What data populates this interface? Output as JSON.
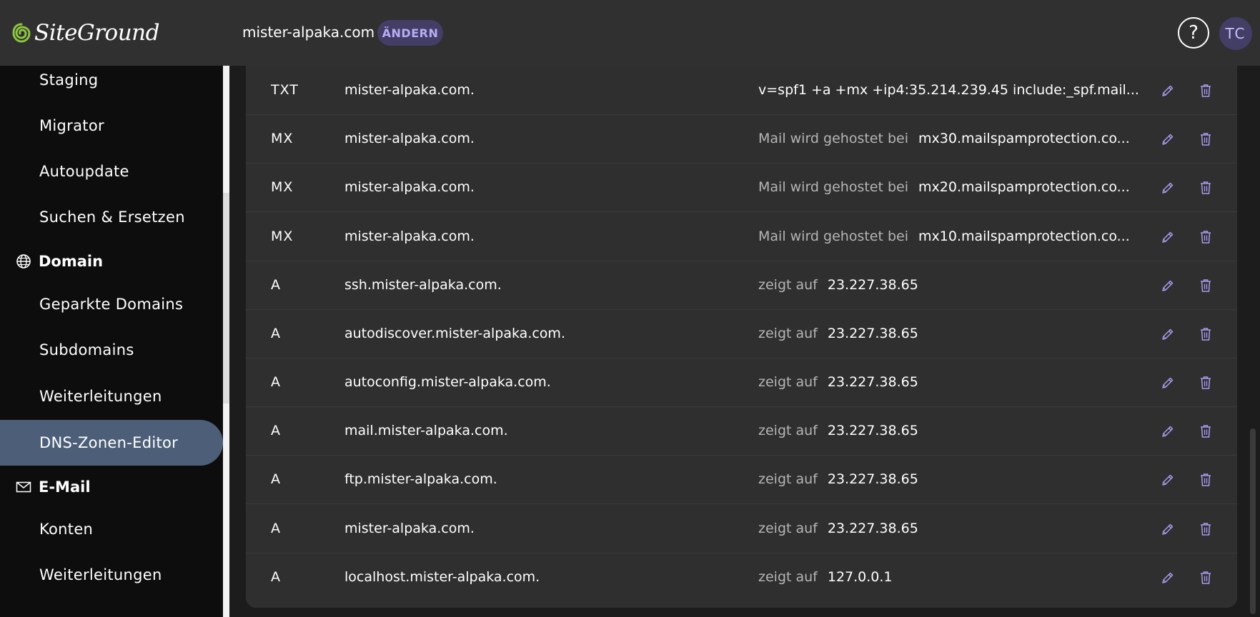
{
  "brand": {
    "name": "SiteGround",
    "accent": "#8cc63f"
  },
  "header": {
    "domain": "mister-alpaka.com",
    "change_label": "ÄNDERN",
    "help_symbol": "?",
    "avatar_initials": "TC"
  },
  "sidebar": {
    "items": [
      {
        "label": "Staging"
      },
      {
        "label": "Migrator"
      },
      {
        "label": "Autoupdate"
      },
      {
        "label": "Suchen & Ersetzen"
      }
    ],
    "domain_section": {
      "label": "Domain",
      "icon": "globe-icon"
    },
    "domain_items": [
      {
        "label": "Geparkte Domains"
      },
      {
        "label": "Subdomains"
      },
      {
        "label": "Weiterleitungen"
      },
      {
        "label": "DNS-Zonen-Editor",
        "active": true
      }
    ],
    "email_section": {
      "label": "E-Mail",
      "icon": "envelope-icon"
    },
    "email_items": [
      {
        "label": "Konten"
      },
      {
        "label": "Weiterleitungen"
      }
    ]
  },
  "records": [
    {
      "type": "TXT",
      "name": "mister-alpaka.com.",
      "prefix": "",
      "value": "v=spf1 +a +mx +ip4:35.214.239.45 include:_spf.mail..."
    },
    {
      "type": "MX",
      "name": "mister-alpaka.com.",
      "prefix": "Mail wird gehostet bei",
      "value": "mx30.mailspamprotection.co..."
    },
    {
      "type": "MX",
      "name": "mister-alpaka.com.",
      "prefix": "Mail wird gehostet bei",
      "value": "mx20.mailspamprotection.co..."
    },
    {
      "type": "MX",
      "name": "mister-alpaka.com.",
      "prefix": "Mail wird gehostet bei",
      "value": "mx10.mailspamprotection.co..."
    },
    {
      "type": "A",
      "name": "ssh.mister-alpaka.com.",
      "prefix": "zeigt auf",
      "value": "23.227.38.65"
    },
    {
      "type": "A",
      "name": "autodiscover.mister-alpaka.com.",
      "prefix": "zeigt auf",
      "value": "23.227.38.65"
    },
    {
      "type": "A",
      "name": "autoconfig.mister-alpaka.com.",
      "prefix": "zeigt auf",
      "value": "23.227.38.65"
    },
    {
      "type": "A",
      "name": "mail.mister-alpaka.com.",
      "prefix": "zeigt auf",
      "value": "23.227.38.65"
    },
    {
      "type": "A",
      "name": "ftp.mister-alpaka.com.",
      "prefix": "zeigt auf",
      "value": "23.227.38.65"
    },
    {
      "type": "A",
      "name": "mister-alpaka.com.",
      "prefix": "zeigt auf",
      "value": "23.227.38.65"
    },
    {
      "type": "A",
      "name": "localhost.mister-alpaka.com.",
      "prefix": "zeigt auf",
      "value": "127.0.0.1"
    }
  ],
  "actions": {
    "edit_icon": "pencil-icon",
    "delete_icon": "trash-icon",
    "icon_color": "#a99cf0"
  }
}
